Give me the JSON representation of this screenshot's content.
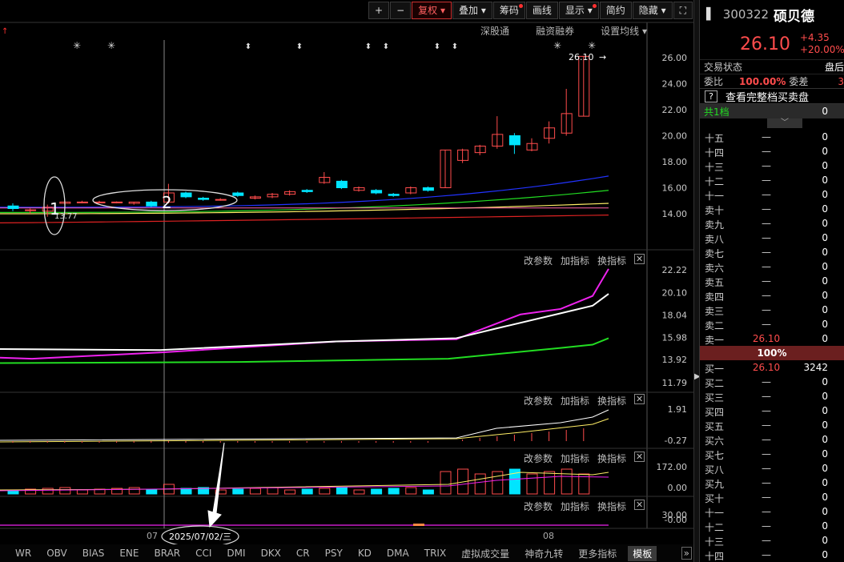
{
  "toolbar": {
    "plus": "+",
    "minus": "−",
    "fuquan": "复权",
    "diejia": "叠加",
    "chouma": "筹码",
    "huaxian": "画线",
    "xianshi": "显示",
    "jianyue": "简约",
    "yincang": "隐藏",
    "fullscreen": "⛶"
  },
  "subbar": {
    "shengutong": "深股通",
    "rongzi": "融资融券",
    "junxian": "设置均线"
  },
  "panel_controls": {
    "change_params": "改参数",
    "add_indicator": "加指标",
    "switch_indicator": "换指标",
    "close": "✕"
  },
  "annotations": {
    "circle1": "1",
    "circle2": "2",
    "date_label": "2025/07/02/三",
    "last_price_label": "26.10",
    "low_label": "13.77"
  },
  "xaxis": {
    "label1": "07",
    "label2": "08"
  },
  "price_axis": [
    "26.00",
    "24.00",
    "22.00",
    "20.00",
    "18.00",
    "16.00",
    "14.00"
  ],
  "ind1_axis": [
    "22.22",
    "20.10",
    "18.04",
    "15.98",
    "13.92",
    "11.79"
  ],
  "ind2_axis": [
    "1.91",
    "-0.27"
  ],
  "ind3_axis": [
    "172.00",
    "0.00"
  ],
  "ind4_axis": [
    "30.00",
    "-0.00"
  ],
  "tabs": [
    "WR",
    "OBV",
    "BIAS",
    "ENE",
    "BRAR",
    "CCI",
    "DMI",
    "DKX",
    "CR",
    "PSY",
    "KD",
    "DMA",
    "TRIX",
    "虚拟成交量",
    "神奇九转",
    "更多指标",
    "模板"
  ],
  "stock": {
    "code": "300322",
    "name": "硕贝德",
    "price": "26.10",
    "change": "+4.35",
    "change_pct": "+20.00%"
  },
  "info": {
    "status_label": "交易状态",
    "status_value": "盘后",
    "weibi_label": "委比",
    "weibi_value": "100.00%",
    "weicha_label": "委差",
    "weicha_value": "3",
    "book_label": "查看完整档买卖盘",
    "qmark": "?",
    "gong_label": "共1档",
    "gong_value": "0"
  },
  "ratio_bar": "100%",
  "sell_levels": [
    {
      "label": "十五",
      "price": "—",
      "vol": "0"
    },
    {
      "label": "十四",
      "price": "—",
      "vol": "0"
    },
    {
      "label": "十三",
      "price": "—",
      "vol": "0"
    },
    {
      "label": "十二",
      "price": "—",
      "vol": "0"
    },
    {
      "label": "十一",
      "price": "—",
      "vol": "0"
    },
    {
      "label": "卖十",
      "price": "—",
      "vol": "0"
    },
    {
      "label": "卖九",
      "price": "—",
      "vol": "0"
    },
    {
      "label": "卖八",
      "price": "—",
      "vol": "0"
    },
    {
      "label": "卖七",
      "price": "—",
      "vol": "0"
    },
    {
      "label": "卖六",
      "price": "—",
      "vol": "0"
    },
    {
      "label": "卖五",
      "price": "—",
      "vol": "0"
    },
    {
      "label": "卖四",
      "price": "—",
      "vol": "0"
    },
    {
      "label": "卖三",
      "price": "—",
      "vol": "0"
    },
    {
      "label": "卖二",
      "price": "—",
      "vol": "0"
    },
    {
      "label": "卖一",
      "price": "26.10",
      "vol": "0"
    }
  ],
  "buy_levels": [
    {
      "label": "买一",
      "price": "26.10",
      "vol": "3242"
    },
    {
      "label": "买二",
      "price": "—",
      "vol": "0"
    },
    {
      "label": "买三",
      "price": "—",
      "vol": "0"
    },
    {
      "label": "买四",
      "price": "—",
      "vol": "0"
    },
    {
      "label": "买五",
      "price": "—",
      "vol": "0"
    },
    {
      "label": "买六",
      "price": "—",
      "vol": "0"
    },
    {
      "label": "买七",
      "price": "—",
      "vol": "0"
    },
    {
      "label": "买八",
      "price": "—",
      "vol": "0"
    },
    {
      "label": "买九",
      "price": "—",
      "vol": "0"
    },
    {
      "label": "买十",
      "price": "—",
      "vol": "0"
    },
    {
      "label": "十一",
      "price": "—",
      "vol": "0"
    },
    {
      "label": "十二",
      "price": "—",
      "vol": "0"
    },
    {
      "label": "十三",
      "price": "—",
      "vol": "0"
    },
    {
      "label": "十四",
      "price": "—",
      "vol": "0"
    }
  ],
  "colors": {
    "up": "#ff4c4c",
    "down": "#00e5ff",
    "ma_blue": "#2233ff",
    "ma_green": "#22dd22",
    "ma_yellow": "#ffee66",
    "ma_red": "#dd2222",
    "magenta": "#ee22ee"
  },
  "chart_data": {
    "type": "candlestick",
    "candles": [
      {
        "o": 14.6,
        "c": 14.4,
        "h": 14.8,
        "l": 14.2
      },
      {
        "o": 14.3,
        "c": 14.3,
        "h": 14.4,
        "l": 14.0
      },
      {
        "o": 14.2,
        "c": 14.5,
        "h": 14.7,
        "l": 13.77
      },
      {
        "o": 14.8,
        "c": 14.9,
        "h": 15.0,
        "l": 14.7
      },
      {
        "o": 14.9,
        "c": 14.9,
        "h": 15.0,
        "l": 14.8
      },
      {
        "o": 14.9,
        "c": 14.9,
        "h": 15.0,
        "l": 14.8
      },
      {
        "o": 14.9,
        "c": 14.9,
        "h": 14.95,
        "l": 14.8
      },
      {
        "o": 14.8,
        "c": 14.9,
        "h": 14.9,
        "l": 14.7
      },
      {
        "o": 14.9,
        "c": 14.6,
        "h": 15.0,
        "l": 14.5
      },
      {
        "o": 14.9,
        "c": 15.6,
        "h": 16.3,
        "l": 14.8
      },
      {
        "o": 15.6,
        "c": 15.3,
        "h": 15.7,
        "l": 15.2
      },
      {
        "o": 15.2,
        "c": 15.1,
        "h": 15.3,
        "l": 15.0
      },
      {
        "o": 15.1,
        "c": 15.1,
        "h": 15.2,
        "l": 15.0
      },
      {
        "o": 15.6,
        "c": 15.4,
        "h": 15.7,
        "l": 15.3
      },
      {
        "o": 15.2,
        "c": 15.3,
        "h": 15.4,
        "l": 15.1
      },
      {
        "o": 15.3,
        "c": 15.5,
        "h": 15.6,
        "l": 15.2
      },
      {
        "o": 15.5,
        "c": 15.7,
        "h": 15.8,
        "l": 15.4
      },
      {
        "o": 15.8,
        "c": 15.7,
        "h": 15.9,
        "l": 15.6
      },
      {
        "o": 16.4,
        "c": 16.8,
        "h": 17.2,
        "l": 16.3
      },
      {
        "o": 16.5,
        "c": 16.0,
        "h": 16.6,
        "l": 15.9
      },
      {
        "o": 15.8,
        "c": 16.0,
        "h": 16.1,
        "l": 15.7
      },
      {
        "o": 15.8,
        "c": 15.6,
        "h": 15.9,
        "l": 15.5
      },
      {
        "o": 15.5,
        "c": 15.4,
        "h": 15.6,
        "l": 15.3
      },
      {
        "o": 15.6,
        "c": 16.0,
        "h": 16.1,
        "l": 15.5
      },
      {
        "o": 16.0,
        "c": 15.8,
        "h": 16.1,
        "l": 15.7
      },
      {
        "o": 16.0,
        "c": 18.9,
        "h": 18.9,
        "l": 16.0
      },
      {
        "o": 18.1,
        "c": 18.9,
        "h": 19.0,
        "l": 17.9
      },
      {
        "o": 18.7,
        "c": 19.2,
        "h": 19.3,
        "l": 18.5
      },
      {
        "o": 19.2,
        "c": 20.1,
        "h": 21.5,
        "l": 19.0
      },
      {
        "o": 20.0,
        "c": 19.3,
        "h": 20.2,
        "l": 18.6
      },
      {
        "o": 18.9,
        "c": 19.4,
        "h": 19.8,
        "l": 18.8
      },
      {
        "o": 19.8,
        "c": 20.6,
        "h": 21.1,
        "l": 19.4
      },
      {
        "o": 20.2,
        "c": 21.7,
        "h": 23.6,
        "l": 20.0
      },
      {
        "o": 21.5,
        "c": 26.1,
        "h": 26.1,
        "l": 21.5
      }
    ],
    "ylim": [
      13.0,
      27.0
    ]
  }
}
